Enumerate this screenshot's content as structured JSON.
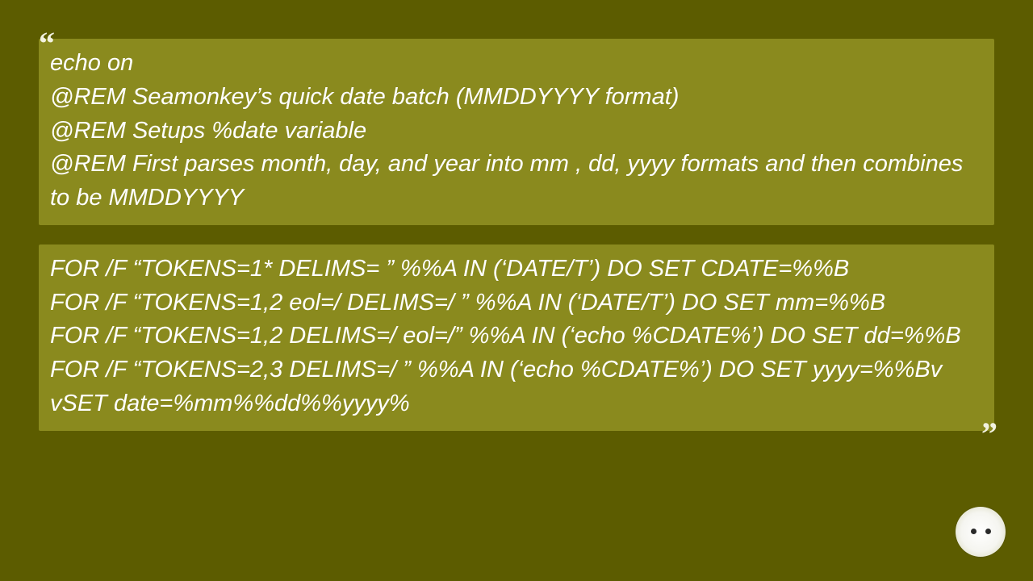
{
  "quote_open": "“",
  "quote_close": "”",
  "block1": {
    "lines": [
      "echo on",
      "@REM Seamonkey’s quick date batch (MMDDYYYY format)",
      "@REM Setups %date variable",
      "@REM First parses month, day, and year into mm , dd, yyyy formats and then combines to be MMDDYYYY"
    ]
  },
  "block2": {
    "lines": [
      "FOR /F “TOKENS=1* DELIMS= ” %%A IN (‘DATE/T’) DO SET CDATE=%%B",
      "FOR /F “TOKENS=1,2 eol=/ DELIMS=/ ” %%A IN (‘DATE/T’) DO SET mm=%%B",
      "FOR /F “TOKENS=1,2 DELIMS=/ eol=/” %%A IN (‘echo %CDATE%’) DO SET dd=%%B",
      "FOR /F “TOKENS=2,3 DELIMS=/ ” %%A IN (‘echo %CDATE%’) DO SET yyyy=%%Bv",
      "vSET date=%mm%%dd%%yyyy%"
    ]
  },
  "emoji_name": "neutral-face-emoji"
}
